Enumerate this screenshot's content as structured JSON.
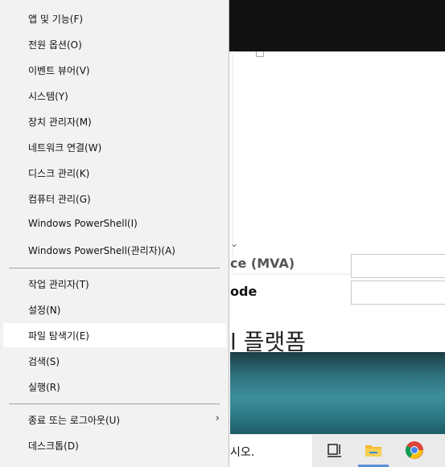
{
  "menu": {
    "items": [
      {
        "label": "앱 및 기능(F)"
      },
      {
        "label": "전원 옵션(O)"
      },
      {
        "label": "이벤트 뷰어(V)"
      },
      {
        "label": "시스템(Y)"
      },
      {
        "label": "장치 관리자(M)"
      },
      {
        "label": "네트워크 연결(W)"
      },
      {
        "label": "디스크 관리(K)"
      },
      {
        "label": "컴퓨터 관리(G)"
      },
      {
        "label": "Windows PowerShell(I)"
      },
      {
        "label": "Windows PowerShell(관리자)(A)"
      },
      {
        "label": "작업 관리자(T)"
      },
      {
        "label": "설정(N)"
      },
      {
        "label": "파일 탐색기(E)",
        "highlighted": true
      },
      {
        "label": "검색(S)"
      },
      {
        "label": "실행(R)"
      },
      {
        "label": "종료 또는 로그아웃(U)",
        "has_submenu": true
      },
      {
        "label": "데스크톱(D)"
      }
    ],
    "submenu_arrow": "›"
  },
  "background": {
    "label1": "ce (MVA)",
    "label2": "ode",
    "heading": "l 플랫폼",
    "chevron": "⌄"
  },
  "taskbar": {
    "search_text": "시오.",
    "icons": [
      "task-view-icon",
      "file-explorer-icon",
      "chrome-icon"
    ],
    "accent_color": "#5a8fd6"
  }
}
